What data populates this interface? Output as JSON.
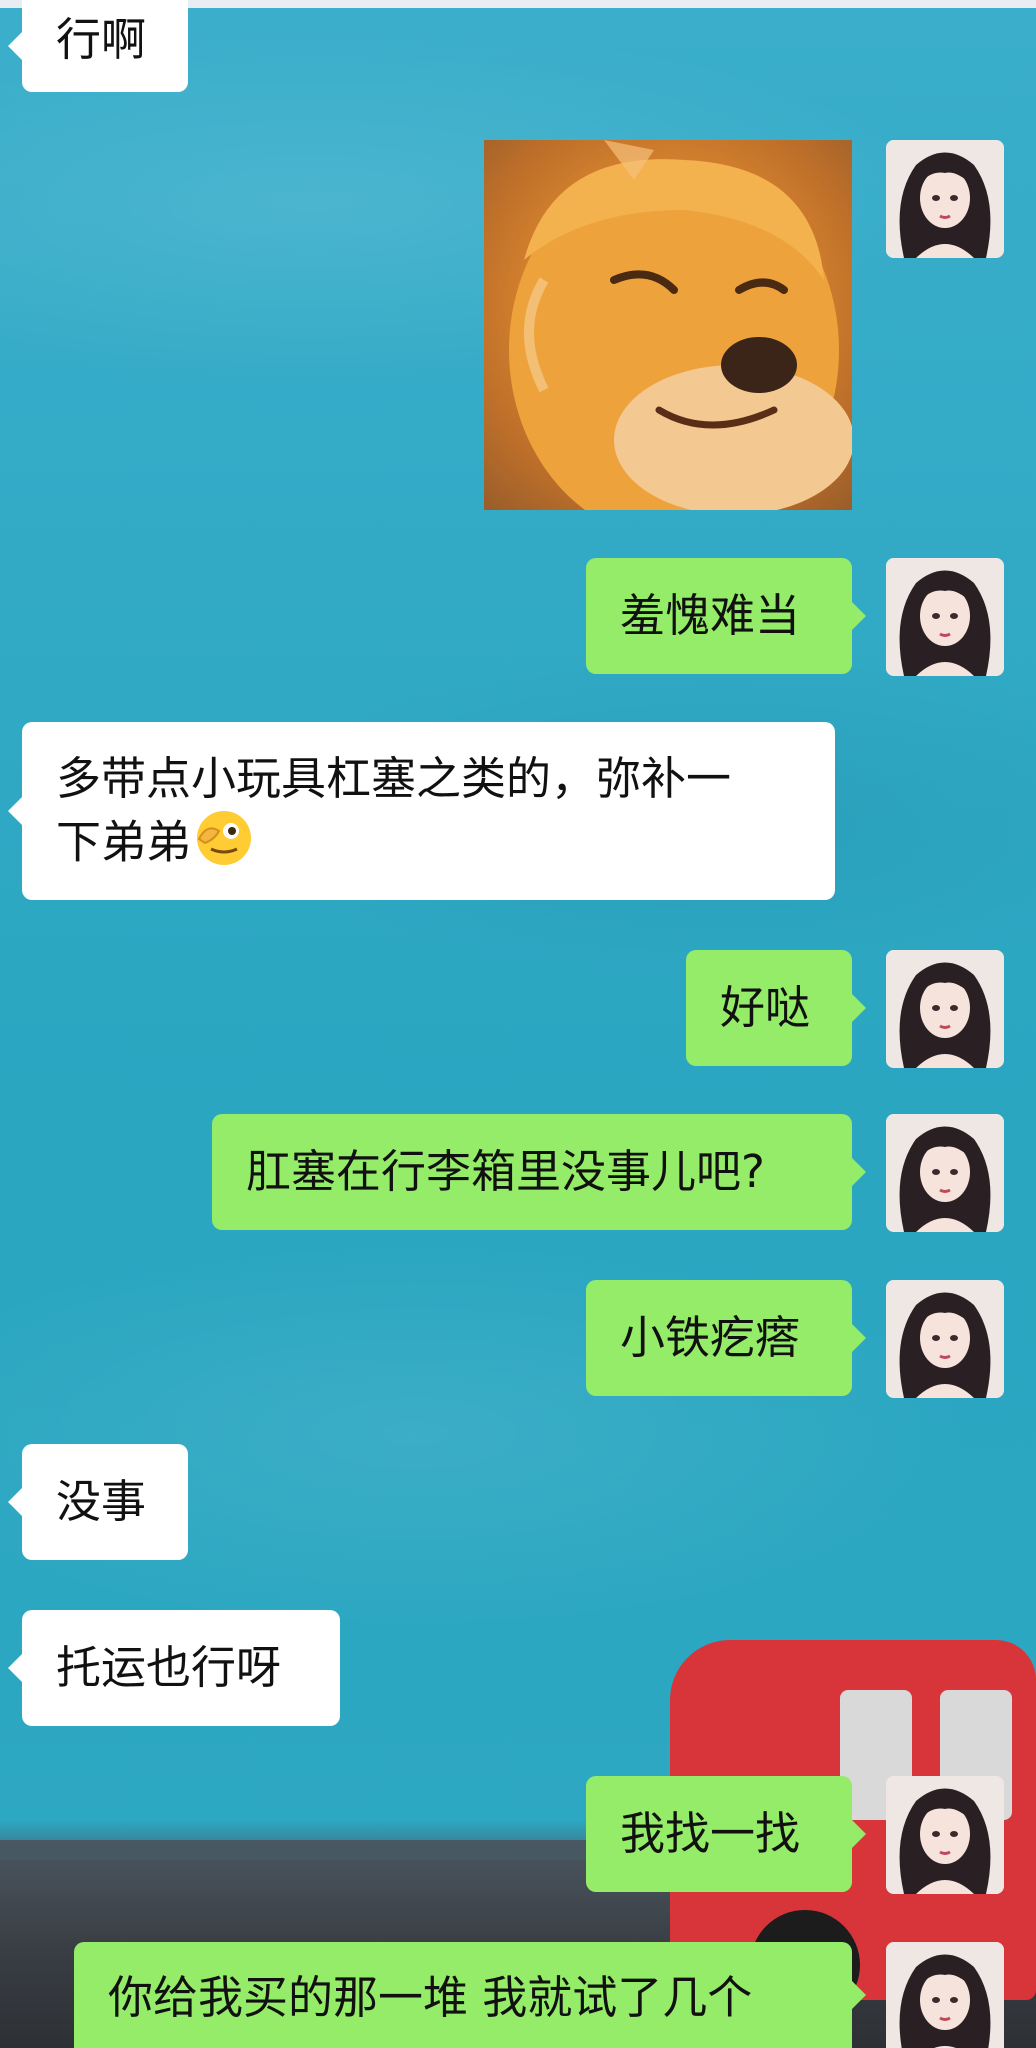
{
  "colors": {
    "background": "#33a9c4",
    "my_bubble": "#95ec69",
    "their_bubble": "#ffffff"
  },
  "messages": [
    {
      "side": "them",
      "text": "行啊"
    },
    {
      "side": "me",
      "type": "sticker",
      "icon": "smug-shiba-dog-sticker"
    },
    {
      "side": "me",
      "text": "羞愧难当"
    },
    {
      "side": "them",
      "text_line1": "多带点小玩具杠塞之类的，弥补一",
      "text_line2": "下弟弟",
      "emoji": "finger-on-eye-emoji"
    },
    {
      "side": "me",
      "text": "好哒"
    },
    {
      "side": "me",
      "text": "肛塞在行李箱里没事儿吧?"
    },
    {
      "side": "me",
      "text": "小铁疙瘩"
    },
    {
      "side": "them",
      "text": "没事"
    },
    {
      "side": "them",
      "text": "托运也行呀"
    },
    {
      "side": "me",
      "text": "我找一找"
    },
    {
      "side": "me",
      "text": "你给我买的那一堆 我就试了几个"
    }
  ],
  "avatar_icon": "anime-girl-avatar-icon"
}
